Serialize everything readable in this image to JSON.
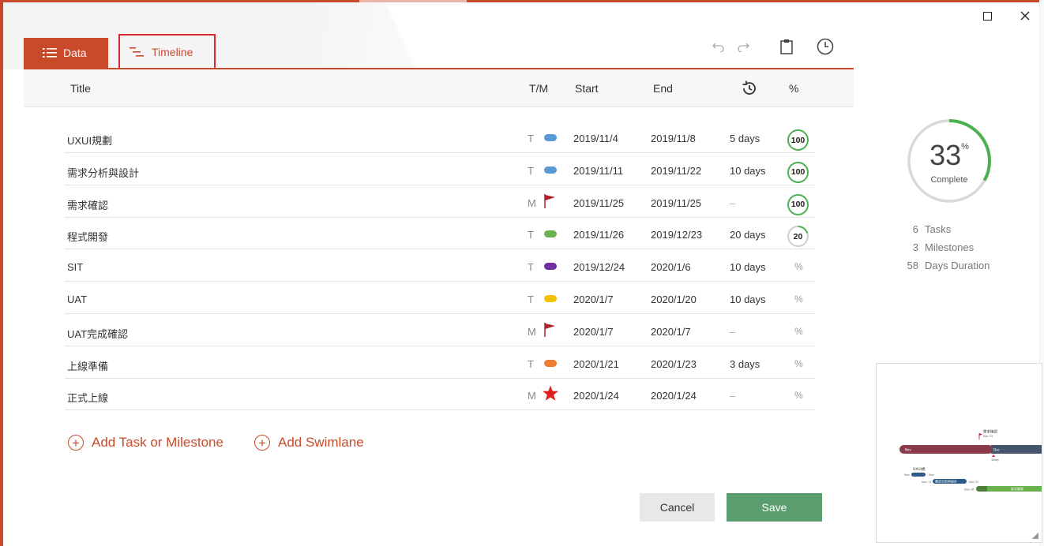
{
  "tabs": {
    "data_label": "Data",
    "timeline_label": "Timeline"
  },
  "header": {
    "title": "Title",
    "tm": "T/M",
    "start": "Start",
    "end": "End",
    "percent": "%"
  },
  "rows": [
    {
      "title": "UXUI規劃",
      "type": "T",
      "marker": "pill",
      "color": "#5b9bd5",
      "start": "2019/11/4",
      "end": "2019/11/8",
      "duration": "5 days",
      "percent": "100"
    },
    {
      "title": "需求分析與設計",
      "type": "T",
      "marker": "pill",
      "color": "#5b9bd5",
      "start": "2019/11/11",
      "end": "2019/11/22",
      "duration": "10 days",
      "percent": "100"
    },
    {
      "title": "需求確認",
      "type": "M",
      "marker": "flag",
      "color": "#b0222a",
      "start": "2019/11/25",
      "end": "2019/11/25",
      "duration": "–",
      "percent": "100"
    },
    {
      "title": "程式開發",
      "type": "T",
      "marker": "pill",
      "color": "#6ab04c",
      "start": "2019/11/26",
      "end": "2019/12/23",
      "duration": "20 days",
      "percent": "20"
    },
    {
      "title": "SIT",
      "type": "T",
      "marker": "pill",
      "color": "#7030a0",
      "start": "2019/12/24",
      "end": "2020/1/6",
      "duration": "10 days",
      "percent": "%"
    },
    {
      "title": "UAT",
      "type": "T",
      "marker": "pill",
      "color": "#f5c200",
      "start": "2020/1/7",
      "end": "2020/1/20",
      "duration": "10 days",
      "percent": "%"
    },
    {
      "title": "UAT完成確認",
      "type": "M",
      "marker": "flag",
      "color": "#b0222a",
      "start": "2020/1/7",
      "end": "2020/1/7",
      "duration": "–",
      "percent": "%"
    },
    {
      "title": "上線準備",
      "type": "T",
      "marker": "pill",
      "color": "#ed7d31",
      "start": "2020/1/21",
      "end": "2020/1/23",
      "duration": "3 days",
      "percent": "%"
    },
    {
      "title": "正式上線",
      "type": "M",
      "marker": "star",
      "color": "#e02020",
      "start": "2020/1/24",
      "end": "2020/1/24",
      "duration": "–",
      "percent": "%"
    }
  ],
  "actions": {
    "add_task": "Add Task or Milestone",
    "add_swimlane": "Add Swimlane",
    "cancel": "Cancel",
    "save": "Save"
  },
  "progress": {
    "value": "33",
    "unit": "%",
    "label": "Complete",
    "fraction": 0.33
  },
  "stats": [
    {
      "n": "6",
      "label": "Tasks"
    },
    {
      "n": "3",
      "label": "Milestones"
    },
    {
      "n": "58",
      "label": "Days Duration"
    }
  ],
  "preview": {
    "months": [
      "Nov",
      "Dec"
    ],
    "milestone_label": "需求確認",
    "milestone_date": "Nov 25",
    "today_label": "Today",
    "tasks": [
      {
        "label": "UXUI規",
        "start": "Nov",
        "end": "Nov"
      },
      {
        "label": "需求分析與設計",
        "start": "Nov 11",
        "end": "Nov 22"
      },
      {
        "label": "程式開發",
        "start": "Nov 26",
        "end": ""
      }
    ]
  },
  "colors": {
    "accent": "#c9492b",
    "complete_green": "#4caf50",
    "save_green": "#5a9e6f"
  }
}
